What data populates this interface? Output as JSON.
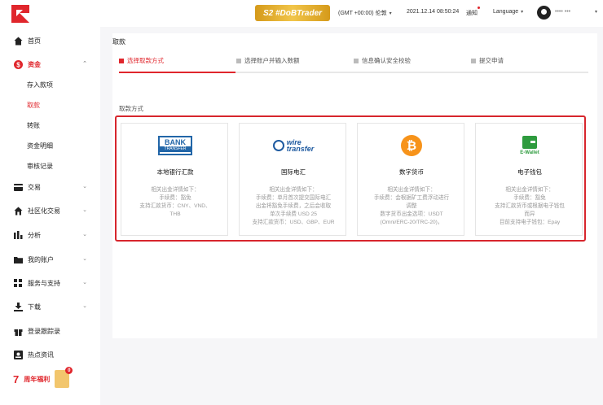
{
  "sidebar": {
    "home": "首页",
    "funds": "资金",
    "funds_sub": [
      "存入款项",
      "取款",
      "转账",
      "资金明细",
      "审核记录"
    ],
    "trade": "交易",
    "social": "社区化交易",
    "analysis": "分析",
    "account": "我的账户",
    "service": "服务与支持",
    "download": "下载",
    "login_record": "登录跟踪录",
    "news": "热点资讯",
    "anniversary": "周年福利",
    "anniversary_number": "7",
    "gift_badge": "0"
  },
  "topbar": {
    "promo": "S2 #DoBTrader",
    "timezone": "(GMT +00:00) 伦敦",
    "datetime": "2021.12.14 08:50:24",
    "notice": "通知",
    "language": "Language",
    "username": "•••• •••"
  },
  "page": {
    "title": "取款",
    "steps": [
      "选择取款方式",
      "选择账户并输入数额",
      "信息确认安全校验",
      "提交申请"
    ],
    "section_label": "取款方式"
  },
  "methods": [
    {
      "name": "本地银行汇款",
      "icon": "bank-transfer-icon",
      "desc": [
        "相关出金详情如下：",
        "手续费：豁免",
        "支持汇款货币：CNY、VND、",
        "THB"
      ]
    },
    {
      "name": "国际电汇",
      "icon": "wire-transfer-icon",
      "desc": [
        "相关出金详情如下：",
        "手续费：单月首次提交国际电汇",
        "出金将豁免手续费，之后会收取",
        "单次手续费 USD 25",
        "支持汇款货币：USD、GBP、EUR"
      ]
    },
    {
      "name": "数字货币",
      "icon": "bitcoin-icon",
      "desc": [
        "相关出金详情如下：",
        "手续费：会根据矿工费浮动进行",
        "调整",
        "数字货币出金选项：USDT",
        "(Omni/ERC-20/TRC-20)，"
      ]
    },
    {
      "name": "电子钱包",
      "icon": "e-wallet-icon",
      "desc": [
        "相关出金详情如下：",
        "手续费：豁免",
        "支持汇款货币或根据电子钱包",
        "而异",
        "目前支持电子钱包：Epay"
      ]
    }
  ],
  "logos": {
    "bank_top": "BANK",
    "bank_bottom": "TRANSFER",
    "wire_top": "wire",
    "wire_bottom": "transfer",
    "btc": "₿",
    "ewallet": "E-Wallet"
  },
  "colors": {
    "accent": "#e0262c",
    "highlight_border": "#d7262d"
  }
}
